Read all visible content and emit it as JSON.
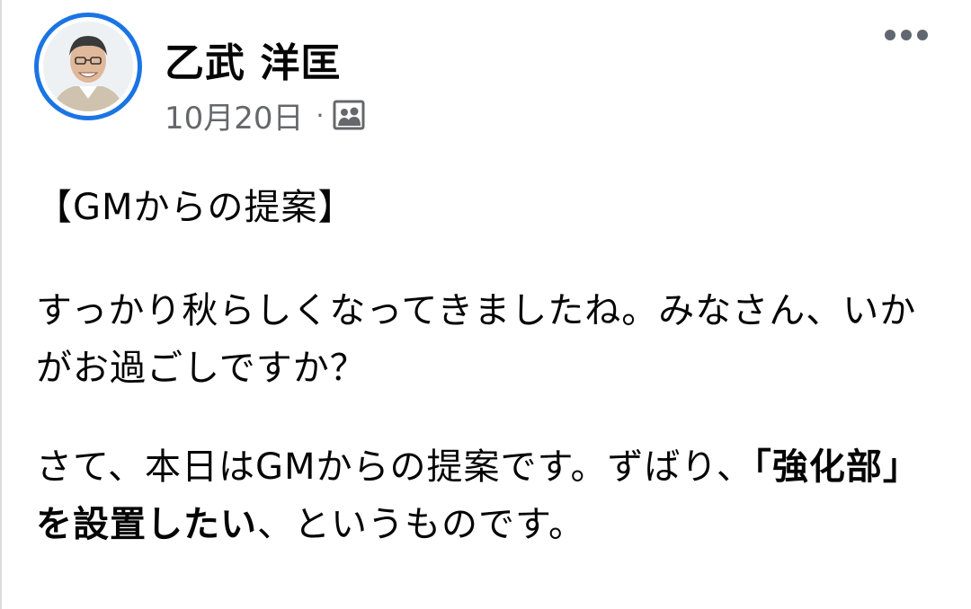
{
  "post": {
    "author_name": "乙武 洋匡",
    "date": "10月20日",
    "separator": "·",
    "audience_icon": "friends-photo-icon",
    "more_icon": "more-dots-icon",
    "heading": "【GMからの提案】",
    "paragraph1": "すっかり秋らしくなってきましたね。みなさん、いかがお過ごしですか？",
    "paragraph2_lead": "さて、本日はGMからの提案です。ずばり、",
    "paragraph2_bold": "「強化部」を設置したい",
    "paragraph2_tail": "、というものです。"
  },
  "colors": {
    "avatar_ring": "#1b74e4",
    "meta_text": "#65676b",
    "body_text": "#050505"
  }
}
